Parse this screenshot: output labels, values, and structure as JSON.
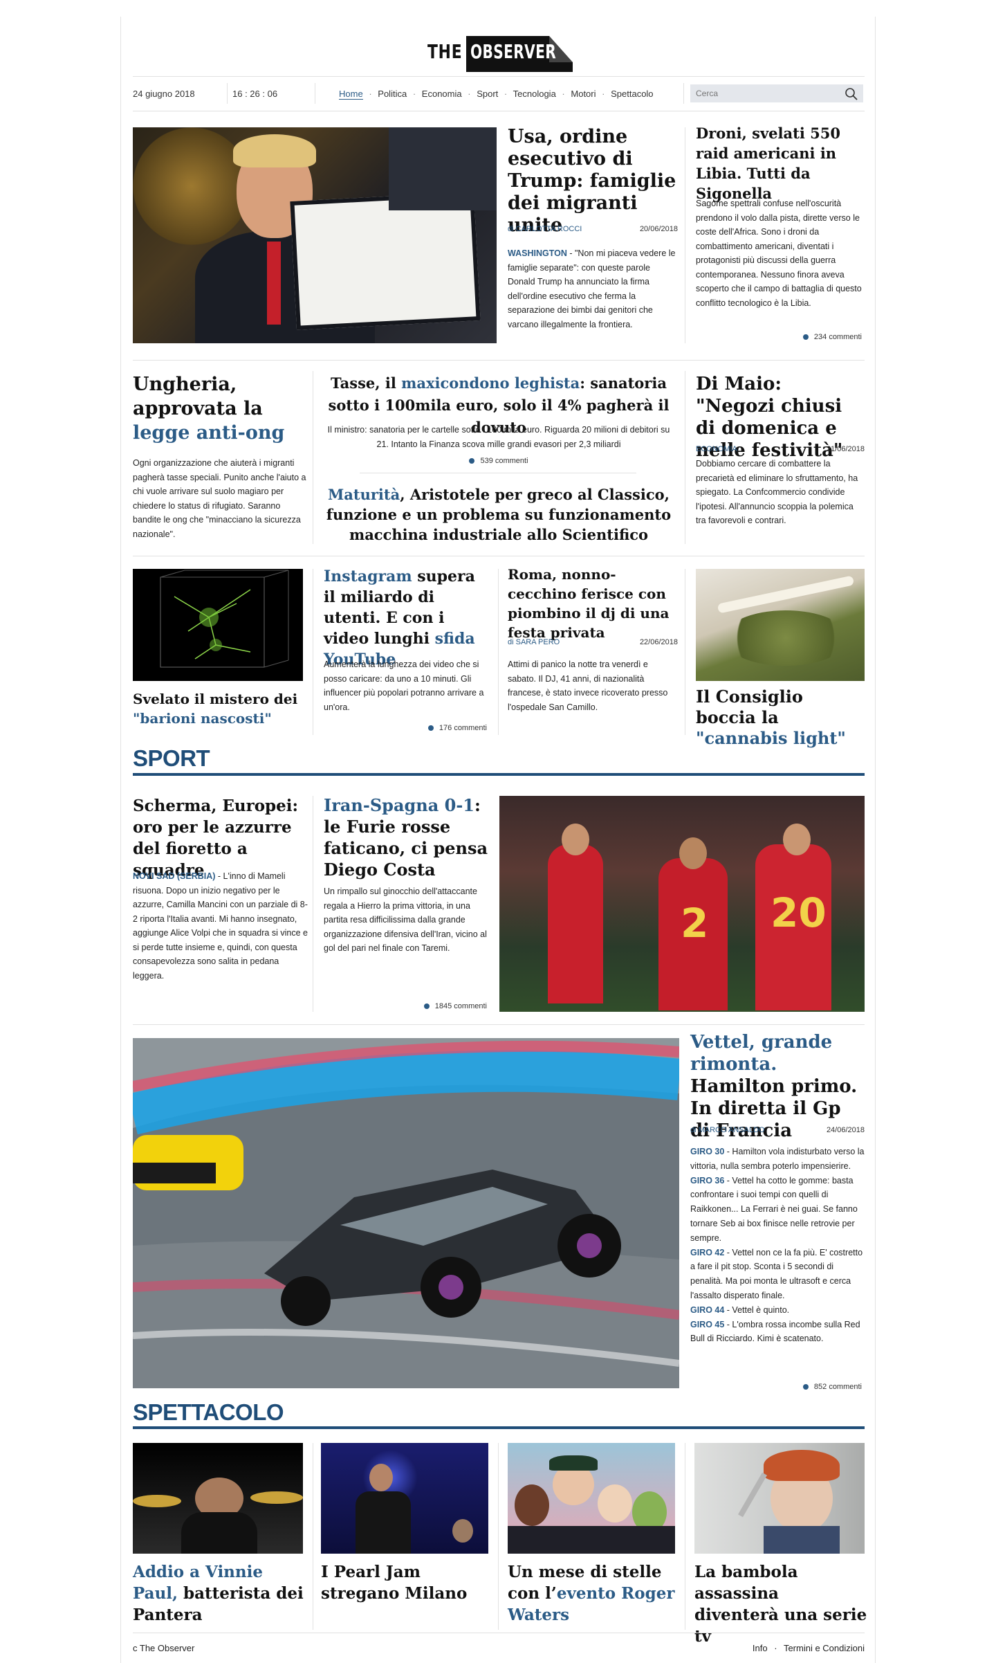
{
  "brand": {
    "the": "THE",
    "name": "OBSERVER"
  },
  "topbar": {
    "date": "24 giugno 2018",
    "time": "16 : 26 : 06",
    "search_placeholder": "Cerca"
  },
  "nav": [
    "Home",
    "Politica",
    "Economia",
    "Sport",
    "Tecnologia",
    "Motori",
    "Spettacolo"
  ],
  "nav_sep": "·",
  "top": {
    "lead": {
      "title": "Usa, ordine esecutivo di Trump: famiglie dei migranti unite",
      "author": "di CARLOTTA ROCCI",
      "date": "20/06/2018",
      "place": "WASHINGTON",
      "text": " - \"Non mi piaceva vedere le famiglie separate\": con queste parole Donald Trump ha annunciato la firma dell'ordine esecutivo che ferma la separazione dei bimbi dai genitori che varcano illegalmente la frontiera."
    },
    "side": {
      "title": "Droni, svelati 550 raid americani in Libia. Tutti da Sigonella",
      "text": "Sagome spettrali confuse nell'oscurità prendono il volo dalla pista, dirette verso le coste dell'Africa. Sono i droni da combattimento americani, diventati i protagonisti più discussi della guerra contemporanea. Nessuno finora aveva scoperto che il campo di battaglia di questo conflitto tecnologico è la Libia.",
      "comments": "234 commenti"
    }
  },
  "row2": {
    "left": {
      "t1": "Ungheria, approvata la ",
      "t2": "legge anti-ong",
      "text": "Ogni organizzazione che aiuterà i migranti pagherà tasse speciali. Punito anche l'aiuto a chi vuole arrivare sul suolo magiaro per chiedere lo status di rifugiato. Saranno bandite le ong che \"minacciano la sicurezza nazionale\"."
    },
    "mid1": {
      "t1": "Tasse, il ",
      "t2": "maxicondono leghista",
      "t3": ": sanatoria sotto i 100mila euro, solo il 4% pagherà il dovuto",
      "text": "Il ministro: sanatoria per le cartelle sotto i 100 mila euro. Riguarda 20 milioni di debitori su 21. Intanto la Finanza scova mille grandi evasori per 2,3 miliardi",
      "comments": "539 commenti"
    },
    "mid2": {
      "t1": "Maturità",
      "t2": ", Aristotele per greco al Classico, funzione e un problema su funzionamento macchina industriale allo Scientifico"
    },
    "right": {
      "title": "Di Maio: \"Negozi chiusi di domenica e nelle festività\"",
      "section": "ECONOMIA",
      "date": "21/06/2018",
      "text": "Dobbiamo cercare di combattere la precarietà ed eliminare lo sfruttamento, ha spiegato. La Confcommercio condivide l'ipotesi. All'annuncio scoppia la polemica tra favorevoli e contrari."
    }
  },
  "row3": {
    "a": {
      "t1": "Svelato il mistero dei ",
      "t2": "\"barioni nascosti\""
    },
    "b": {
      "t1": "Instagram",
      "t2": " supera il miliardo di utenti. E con i video lunghi ",
      "t3": "sfida YouTube",
      "text": "Aumenterà la lunghezza dei video che si posso caricare: da uno a 10 minuti. Gli influencer più popolari potranno arrivare a un'ora.",
      "comments": "176 commenti"
    },
    "c": {
      "title": "Roma, nonno- cecchino ferisce con piombino il dj di una festa privata",
      "author": "di SARA PERO",
      "date": "22/06/2018",
      "text": "Attimi di panico la notte tra venerdì e sabato. Il DJ, 41 anni, di nazionalità francese, è stato invece ricoverato presso l'ospedale San Camillo."
    },
    "d": {
      "t1": "Il Consiglio boccia la ",
      "t2": "\"cannabis light\""
    }
  },
  "sport": {
    "heading": "SPORT",
    "a": {
      "title": "Scherma, Europei: oro per le azzurre del fioretto a squadre",
      "place": "NOVI SAD (SERBIA)",
      "text": " - L'inno di Mameli risuona. Dopo un inizio negativo per le azzurre, Camilla Mancini con un parziale di 8-2 riporta l'Italia avanti. Mi hanno insegnato, aggiunge Alice Volpi che in squadra si vince e si perde tutte insieme e, quindi, con questa consapevolezza sono salita in pedana leggera."
    },
    "b": {
      "t1": "Iran-Spagna 0-1",
      "t2": ": le Furie rosse faticano, ci pensa Diego Costa",
      "text": "Un rimpallo sul ginocchio dell'attaccante regala a Hierro la prima vittoria, in una partita resa difficilissima dalla grande organizzazione difensiva dell'Iran, vicino al gol del pari nel finale con Taremi.",
      "comments": "1845 commenti"
    },
    "f1": {
      "t1": "Vettel, grande rimonta.",
      "t2": " Hamilton primo. In diretta il Gp di Francia",
      "author": "di MARCO ANSALDO",
      "date": "24/06/2018",
      "comments": "852 commenti",
      "updates": [
        {
          "lap": "GIRO 30",
          "text": " - Hamilton vola indisturbato verso la vittoria, nulla sembra poterlo impensierire."
        },
        {
          "lap": "GIRO 36",
          "text": " - Vettel ha cotto le gomme: basta confrontare i suoi tempi con quelli di Raikkonen... La Ferrari è nei guai. Se fanno tornare Seb ai box finisce nelle retrovie per sempre."
        },
        {
          "lap": "GIRO 42",
          "text": " - Vettel non ce la fa più. E' costretto a fare il pit stop. Sconta i 5 secondi di penalità. Ma poi monta le ultrasoft e cerca l'assalto disperato finale."
        },
        {
          "lap": "GIRO 44",
          "text": " - Vettel è quinto."
        },
        {
          "lap": "GIRO 45",
          "text": " - L'ombra rossa incombe sulla Red Bull di Ricciardo. Kimi è scatenato."
        }
      ]
    }
  },
  "spettacolo": {
    "heading": "SPETTACOLO",
    "a": {
      "t1": "Addio a Vinnie Paul,",
      "t2": " batterista dei Pantera"
    },
    "b": {
      "t1": "I Pearl Jam stregano Milano"
    },
    "c": {
      "t1": "Un mese di stelle con l’",
      "t2": "evento Roger Waters"
    },
    "d": {
      "t1": "La bambola assassina diventerà una serie tv"
    }
  },
  "footer": {
    "copy": "c The Observer",
    "info": "Info",
    "sep": "·",
    "terms": "Termini e Condizioni"
  },
  "colors": {
    "accent": "#2b5b86",
    "section": "#1f4d78"
  }
}
